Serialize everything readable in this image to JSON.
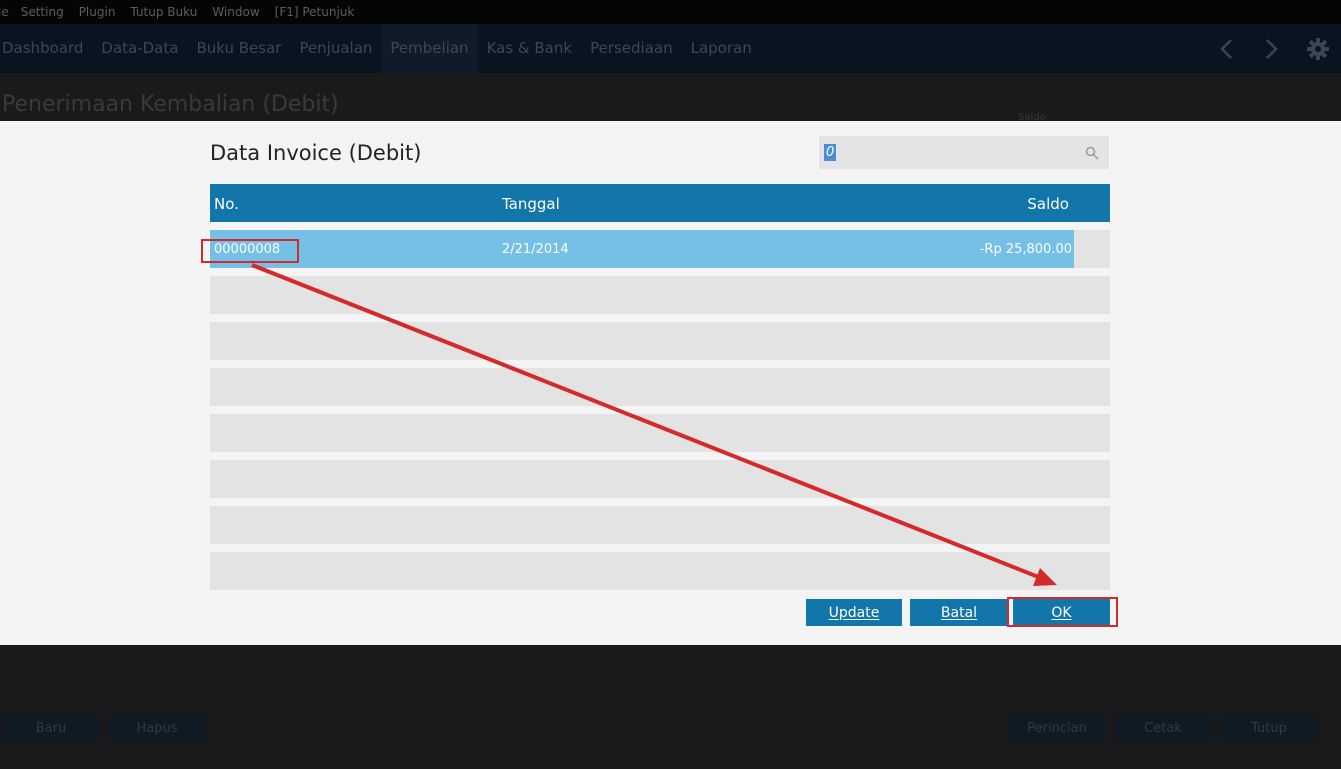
{
  "menubar": {
    "items": [
      "le",
      "Setting",
      "Plugin",
      "Tutup Buku",
      "Window",
      "[F1] Petunjuk"
    ]
  },
  "navbar": {
    "items": [
      "Dashboard",
      "Data-Data",
      "Buku Besar",
      "Penjualan",
      "Pembelian",
      "Kas & Bank",
      "Persediaan",
      "Laporan"
    ],
    "active_index": 4,
    "icons": [
      "chevron-left-icon",
      "chevron-right-icon",
      "gear-icon"
    ]
  },
  "page": {
    "title": "Penerimaan Kembalian (Debit)",
    "small_label": "Saldo"
  },
  "bottom_buttons": {
    "baru": "Baru",
    "hapus": "Hapus",
    "perincian": "Perincian",
    "cetak": "Cetak",
    "tutup": "Tutup"
  },
  "modal": {
    "title": "Data Invoice (Debit)",
    "search": {
      "value": "0",
      "icon": "search-icon"
    },
    "table": {
      "headers": {
        "no": "No.",
        "tanggal": "Tanggal",
        "saldo": "Saldo"
      },
      "rows": [
        {
          "no": "00000008",
          "tanggal": "2/21/2014",
          "saldo": "-Rp 25,800.00",
          "selected": true
        }
      ],
      "empty_rows": 7
    },
    "buttons": {
      "update": "Update",
      "batal": "Batal",
      "ok": "OK"
    }
  },
  "annotation": {
    "color": "#d42a2a"
  },
  "colors": {
    "header_blue": "#1276ab",
    "selected_row": "#74c0e6",
    "empty_row": "#e3e3e3",
    "modal_bg": "#f4f4f4"
  }
}
